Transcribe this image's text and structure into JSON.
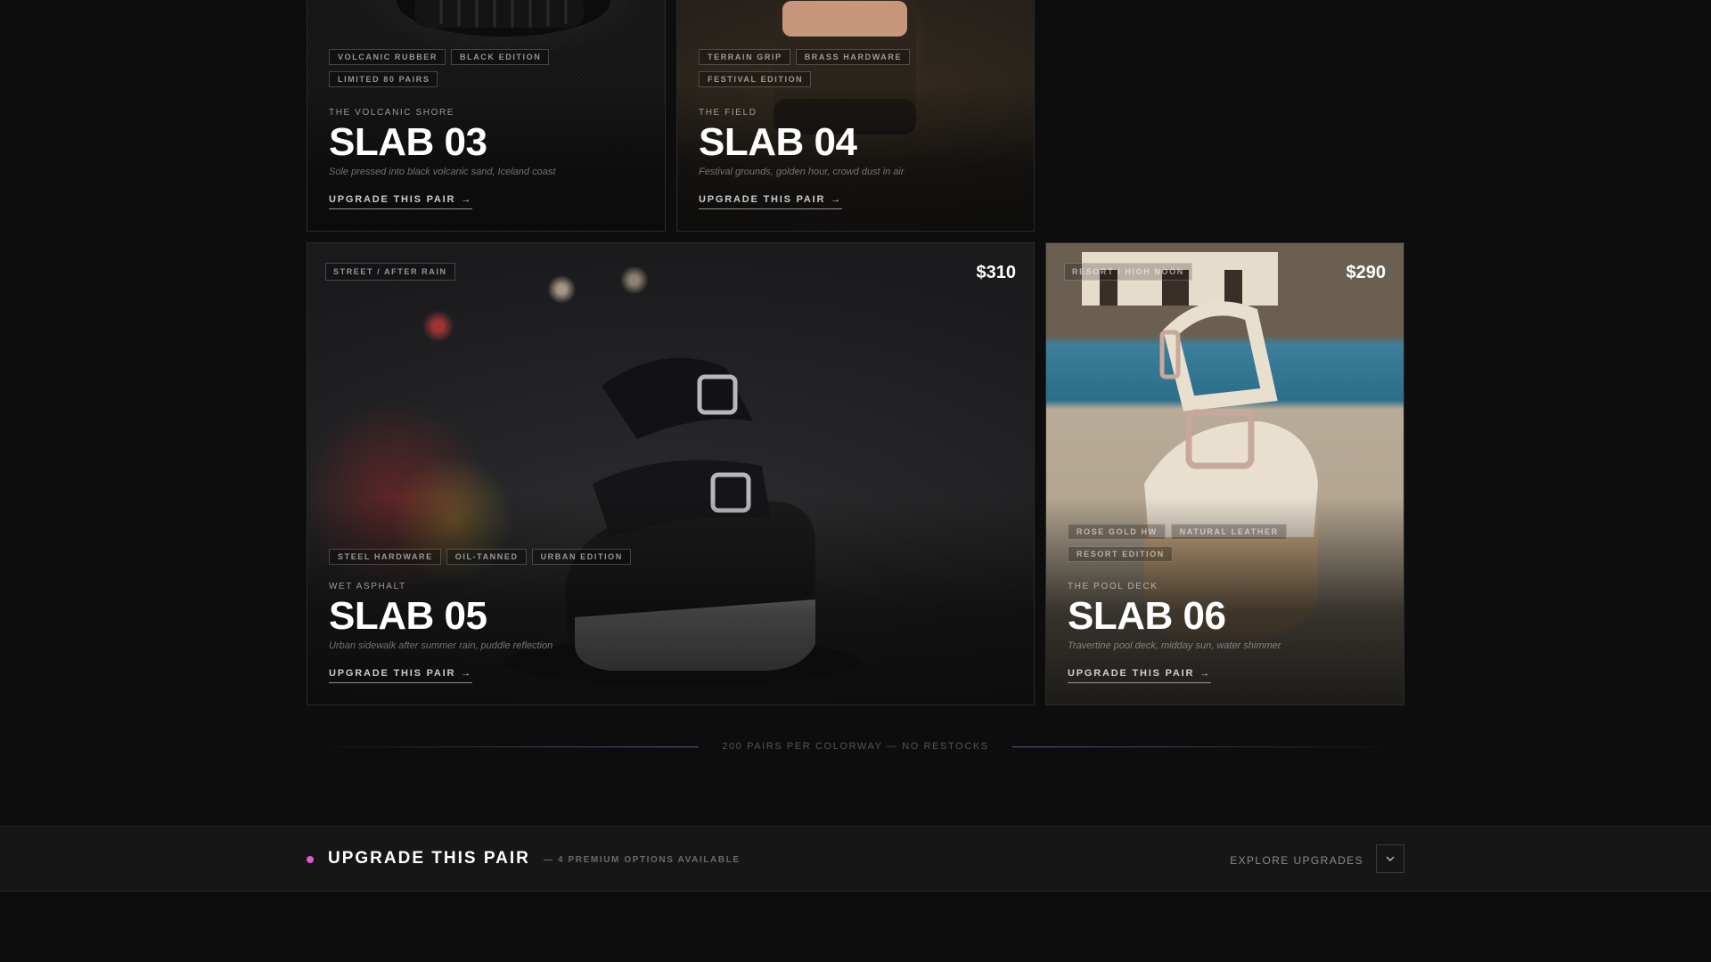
{
  "cards": [
    {
      "id": "slab-03",
      "tags": [
        "VOLCANIC RUBBER",
        "BLACK EDITION",
        "LIMITED 80 PAIRS"
      ],
      "location": "THE VOLCANIC SHORE",
      "title": "SLAB 03",
      "description": "Sole pressed into black volcanic sand, Iceland coast",
      "cta": "UPGRADE THIS PAIR"
    },
    {
      "id": "slab-04",
      "tags": [
        "TERRAIN GRIP",
        "BRASS HARDWARE",
        "FESTIVAL EDITION"
      ],
      "location": "THE FIELD",
      "title": "SLAB 04",
      "description": "Festival grounds, golden hour, crowd dust in air",
      "cta": "UPGRADE THIS PAIR"
    },
    {
      "id": "slab-05",
      "badge": "STREET / AFTER RAIN",
      "price": "$310",
      "tags": [
        "STEEL HARDWARE",
        "OIL-TANNED",
        "URBAN EDITION"
      ],
      "location": "WET ASPHALT",
      "title": "SLAB 05",
      "description": "Urban sidewalk after summer rain, puddle reflection",
      "cta": "UPGRADE THIS PAIR"
    },
    {
      "id": "slab-06",
      "badge": "RESORT / HIGH NOON",
      "price": "$290",
      "tags": [
        "ROSE GOLD HW",
        "NATURAL LEATHER",
        "RESORT EDITION"
      ],
      "location": "THE POOL DECK",
      "title": "SLAB 06",
      "description": "Travertine pool deck, midday sun, water shimmer",
      "cta": "UPGRADE THIS PAIR"
    }
  ],
  "divider": {
    "text": "200 PAIRS PER COLORWAY — NO RESTOCKS"
  },
  "bottom_bar": {
    "title": "UPGRADE THIS PAIR",
    "subtitle": "— 4 PREMIUM OPTIONS AVAILABLE",
    "explore_label": "EXPLORE UPGRADES",
    "accent_color": "#e455c6"
  },
  "icons": {
    "cta_arrow": "arrow-right-icon",
    "toggle": "chevron-down-icon"
  }
}
